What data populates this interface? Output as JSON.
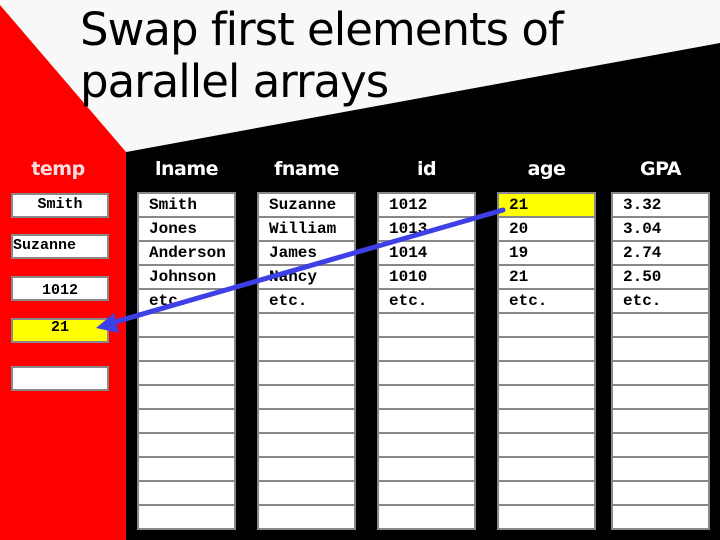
{
  "slide": {
    "title": "Swap first elements of parallel arrays",
    "colors": {
      "background": "#f8f8f8",
      "left_band": "#ff0000",
      "panel": "#000000",
      "highlight": "#ffff00",
      "arrow": "#3f3fe6",
      "cell_border": "#888888"
    }
  },
  "temp": {
    "label": "temp",
    "boxes": [
      {
        "value": "Smith",
        "highlighted": false
      },
      {
        "value": "Suzanne",
        "highlighted": false
      },
      {
        "value": "1012",
        "highlighted": false
      },
      {
        "value": "21",
        "highlighted": true
      },
      {
        "value": "",
        "highlighted": false
      }
    ]
  },
  "arrays": [
    {
      "header": "lname",
      "cells": [
        "Smith",
        "Jones",
        "Anderson",
        "Johnson",
        "etc.",
        "",
        "",
        "",
        "",
        "",
        "",
        "",
        "",
        ""
      ],
      "highlight_index": -1
    },
    {
      "header": "fname",
      "cells": [
        "Suzanne",
        "William",
        "James",
        "Nancy",
        "etc.",
        "",
        "",
        "",
        "",
        "",
        "",
        "",
        "",
        ""
      ],
      "highlight_index": -1
    },
    {
      "header": "id",
      "cells": [
        "1012",
        "1013",
        "1014",
        "1010",
        "etc.",
        "",
        "",
        "",
        "",
        "",
        "",
        "",
        "",
        ""
      ],
      "highlight_index": -1
    },
    {
      "header": "age",
      "cells": [
        "21",
        "20",
        "19",
        "21",
        "etc.",
        "",
        "",
        "",
        "",
        "",
        "",
        "",
        "",
        ""
      ],
      "highlight_index": 0
    },
    {
      "header": "GPA",
      "cells": [
        "3.32",
        "3.04",
        "2.74",
        "2.50",
        "etc.",
        "",
        "",
        "",
        "",
        "",
        "",
        "",
        "",
        ""
      ],
      "highlight_index": -1
    }
  ],
  "arrow": {
    "from": "age[0]",
    "to": "temp box 4",
    "meaning": "copy age[0] into temp"
  }
}
